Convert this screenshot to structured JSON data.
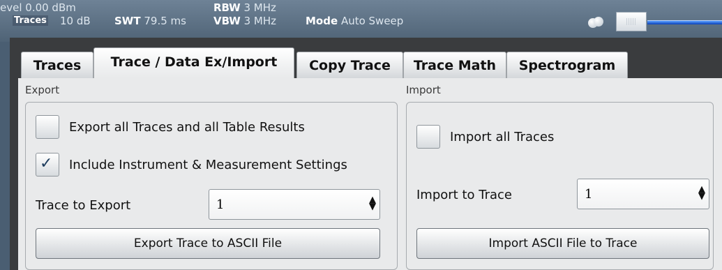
{
  "status_bar": {
    "ref_level": "evel 0.00 dBm",
    "dialog_name": "Traces",
    "att": "10 dB",
    "swt_label": "SWT",
    "swt_value": "79.5 ms",
    "rbw_label": "RBW",
    "rbw_value": "3 MHz",
    "vbw_label": "VBW",
    "vbw_value": "3 MHz",
    "mode_label": "Mode",
    "mode_value": "Auto Sweep"
  },
  "tabs": [
    {
      "label": "Traces",
      "active": false
    },
    {
      "label": "Trace / Data Ex/Import",
      "active": true
    },
    {
      "label": "Copy Trace",
      "active": false
    },
    {
      "label": "Trace Math",
      "active": false
    },
    {
      "label": "Spectrogram",
      "active": false
    }
  ],
  "export": {
    "title": "Export",
    "export_all_label": "Export all Traces and all Table Results",
    "export_all_checked": false,
    "include_settings_label": "Include Instrument & Measurement Settings",
    "include_settings_checked": true,
    "trace_to_export_label": "Trace to Export",
    "trace_to_export_value": "1",
    "button_label": "Export Trace to ASCII File"
  },
  "import": {
    "title": "Import",
    "import_all_label": "Import all Traces",
    "import_all_checked": false,
    "import_to_trace_label": "Import to Trace",
    "import_to_trace_value": "1",
    "button_label": "Import ASCII File to Trace"
  },
  "icons": {
    "checkmark": "✓",
    "spinner_up": "▲",
    "spinner_down": "▼"
  }
}
